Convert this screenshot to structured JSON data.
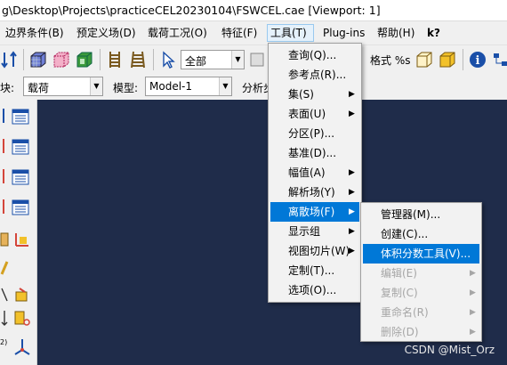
{
  "window": {
    "title": "g\\Desktop\\Projects\\practiceCEL20230104\\FSWCEL.cae [Viewport: 1]"
  },
  "menubar": {
    "items": [
      {
        "label": "边界条件(B)"
      },
      {
        "label": "预定义场(D)"
      },
      {
        "label": "载荷工况(O)"
      },
      {
        "label": "特征(F)"
      },
      {
        "label": "工具(T)"
      },
      {
        "label": "Plug-ins"
      },
      {
        "label": "帮助(H)"
      },
      {
        "label": "k?"
      }
    ]
  },
  "toolbar1": {
    "select_combo_value": "全部",
    "partial_label": "格式 %s"
  },
  "toolbar2": {
    "module_label_partial": "块:",
    "module_value": "载荷",
    "model_label": "模型:",
    "model_value": "Model-1",
    "step_label_partial": "分析步"
  },
  "tools_menu": {
    "items": [
      {
        "label": "查询(Q)..."
      },
      {
        "label": "参考点(R)..."
      },
      {
        "label": "集(S)"
      },
      {
        "label": "表面(U)"
      },
      {
        "label": "分区(P)..."
      },
      {
        "label": "基准(D)..."
      },
      {
        "label": "幅值(A)"
      },
      {
        "label": "解析场(Y)"
      },
      {
        "label": "离散场(F)"
      },
      {
        "label": "显示组"
      },
      {
        "label": "视图切片(W)"
      },
      {
        "label": "定制(T)..."
      },
      {
        "label": "选项(O)..."
      }
    ]
  },
  "discrete_field_menu": {
    "items": [
      {
        "label": "管理器(M)..."
      },
      {
        "label": "创建(C)..."
      },
      {
        "label": "体积分数工具(V)..."
      },
      {
        "label": "编辑(E)"
      },
      {
        "label": "复制(C)"
      },
      {
        "label": "重命名(R)"
      },
      {
        "label": "删除(D)"
      }
    ]
  },
  "watermark": "CSDN @Mist_Orz",
  "colors": {
    "viewport": "#1f2c4a",
    "highlight": "#0078d7"
  }
}
